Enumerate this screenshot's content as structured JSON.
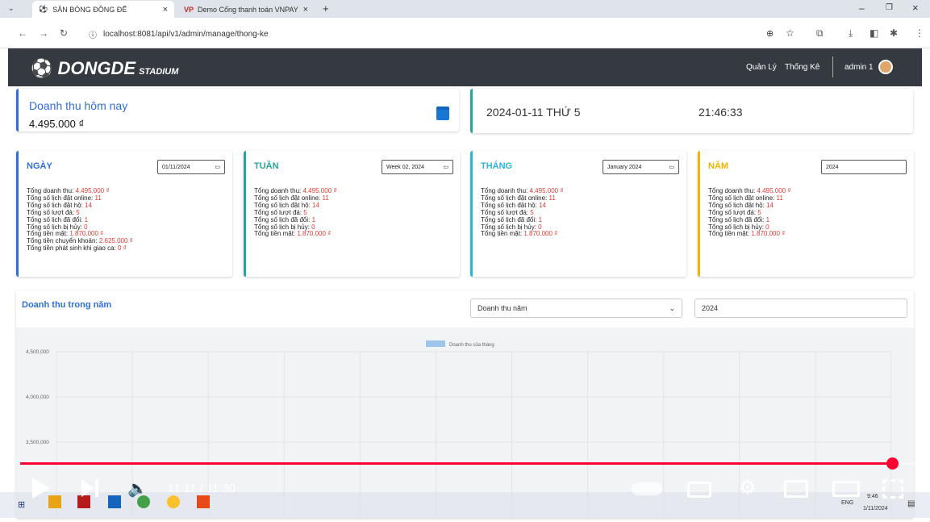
{
  "browser": {
    "tab1": "SÂN BÓNG ĐỒNG ĐẾ",
    "tab2": "Demo Cổng thanh toán VNPAY",
    "url": "localhost:8081/api/v1/admin/manage/thong-ke"
  },
  "header": {
    "logo": "DONGDE",
    "logo_sub": "STADIUM",
    "nav1": "Quản Lý",
    "nav2": "Thống Kê",
    "user": "admin 1"
  },
  "today": {
    "label": "Doanh thu hôm nay",
    "value": "4.495.000 ₫"
  },
  "clock": {
    "date": "2024-01-11 THỨ 5",
    "time": "21:46:33"
  },
  "cards": [
    {
      "title": "NGÀY",
      "input": "01/11/2024",
      "color": "#2f6fd6",
      "lines": [
        [
          "Tổng doanh thu: ",
          "4.495.000 ₫"
        ],
        [
          "Tổng số lịch đặt online: ",
          "11"
        ],
        [
          "Tổng số lịch đặt hộ: ",
          "14"
        ],
        [
          "Tổng số lượt đá: ",
          "5"
        ],
        [
          "Tổng số lịch đã đổi: ",
          "1"
        ],
        [
          "Tổng số lịch bị hủy: ",
          "0"
        ],
        [
          "Tổng tiền mặt: ",
          "1.870.000 ₫"
        ],
        [
          "Tổng tiền chuyển khoản: ",
          "2.625.000 ₫"
        ],
        [
          "Tổng tiền phát sinh khi giao ca: ",
          "0 ₫"
        ]
      ]
    },
    {
      "title": "TUẦN",
      "input": "Week 02, 2024",
      "color": "#26a69a",
      "lines": [
        [
          "Tổng doanh thu: ",
          "4.495.000 ₫"
        ],
        [
          "Tổng số lịch đặt online: ",
          "11"
        ],
        [
          "Tổng số lịch đặt hộ: ",
          "14"
        ],
        [
          "Tổng số lượt đá: ",
          "5"
        ],
        [
          "Tổng số lịch đã đổi: ",
          "1"
        ],
        [
          "Tổng số lịch bị hủy: ",
          "0"
        ],
        [
          "Tổng tiền mặt: ",
          "1.870.000 ₫"
        ]
      ]
    },
    {
      "title": "THÁNG",
      "input": "January 2024",
      "color": "#29b6d6",
      "lines": [
        [
          "Tổng doanh thu: ",
          "4.495.000 ₫"
        ],
        [
          "Tổng số lịch đặt online: ",
          "11"
        ],
        [
          "Tổng số lịch đặt hộ: ",
          "14"
        ],
        [
          "Tổng số lượt đá: ",
          "5"
        ],
        [
          "Tổng số lịch đã đổi: ",
          "1"
        ],
        [
          "Tổng số lịch bị hủy: ",
          "0"
        ],
        [
          "Tổng tiền mặt: ",
          "1.870.000 ₫"
        ]
      ]
    },
    {
      "title": "NĂM",
      "input": "2024",
      "color": "#f4b400",
      "lines": [
        [
          "Tổng doanh thu: ",
          "4.495.000 ₫"
        ],
        [
          "Tổng số lịch đặt online: ",
          "11"
        ],
        [
          "Tổng số lịch đặt hộ: ",
          "14"
        ],
        [
          "Tổng số lượt đá: ",
          "5"
        ],
        [
          "Tổng số lịch đã đổi: ",
          "1"
        ],
        [
          "Tổng số lịch bị hủy: ",
          "0"
        ],
        [
          "Tổng tiền mặt: ",
          "1.870.000 ₫"
        ]
      ]
    }
  ],
  "chart_section": {
    "title": "Doanh thu trong năm",
    "select": "Doanh thu năm",
    "year": "2024"
  },
  "chart_data": {
    "type": "bar",
    "series": [
      {
        "name": "Doanh thu của tháng",
        "values": []
      }
    ],
    "yticks": [
      "4,500,000",
      "4,000,000",
      "3,500,000"
    ],
    "ylim_visible": [
      3500000,
      4500000
    ]
  },
  "video": {
    "time": "11:11 / 11:30",
    "progress": 0.972
  },
  "taskbar": {
    "time": "9:46",
    "date": "1/11/2024",
    "lang": "ENG"
  }
}
